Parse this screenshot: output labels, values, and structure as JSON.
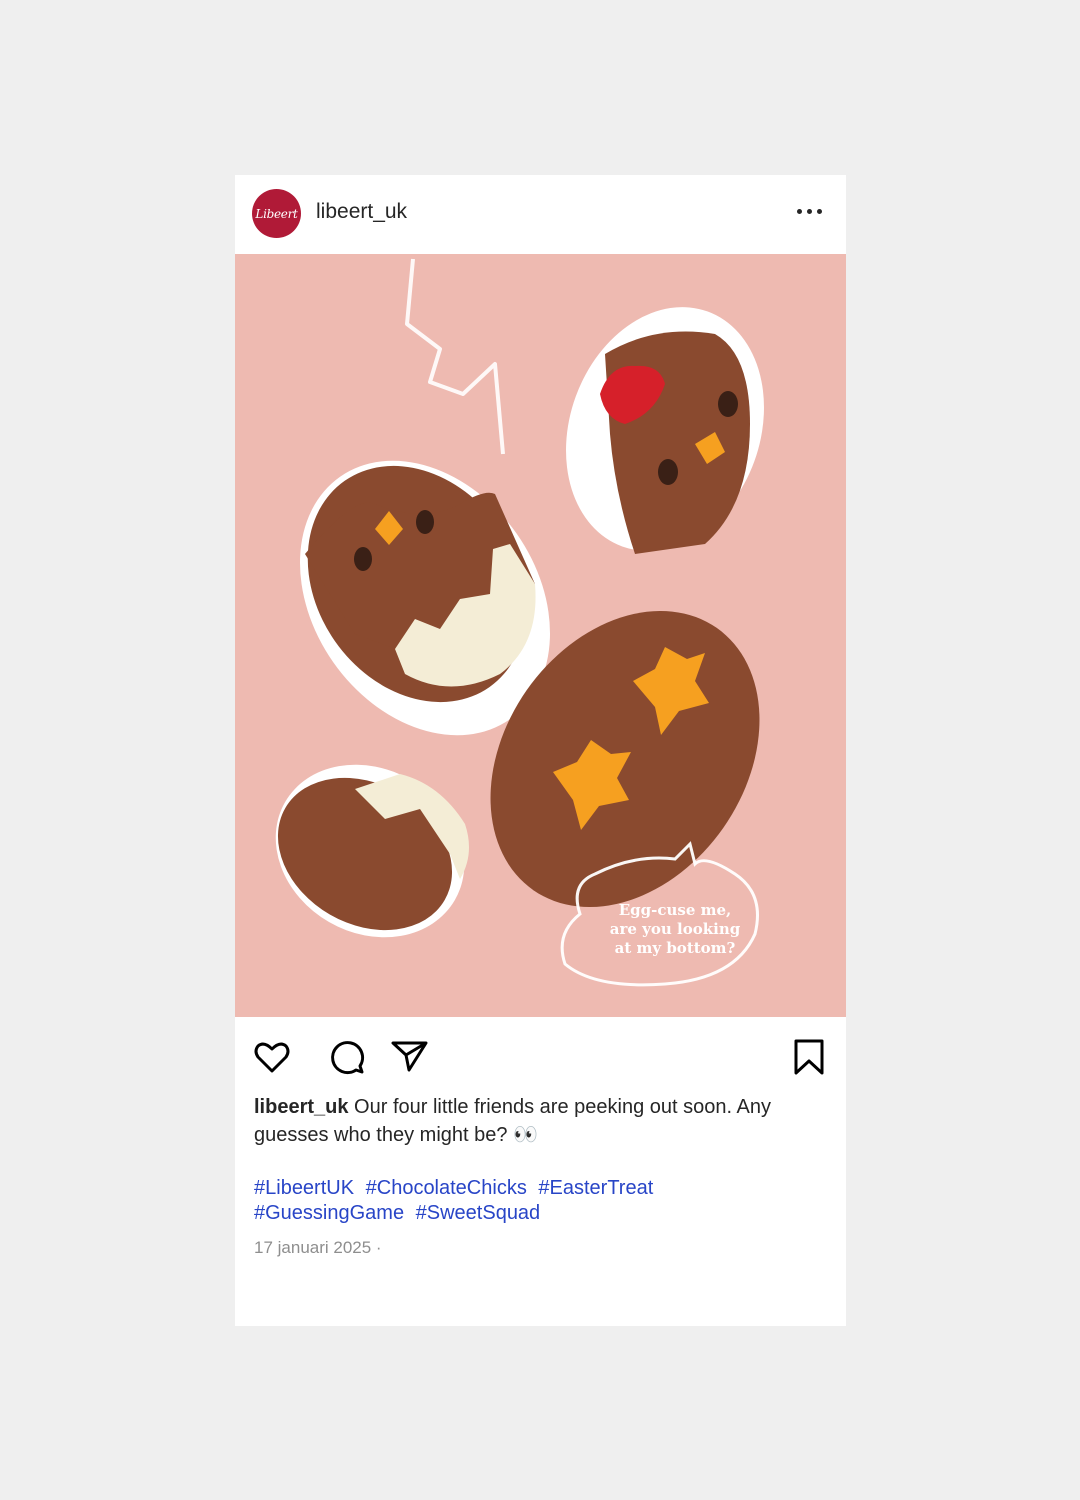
{
  "post": {
    "username": "libeert_uk",
    "avatar_text": "Libeert",
    "image_overlay": {
      "line1": "Egg-cuse me,",
      "line2": "are you looking",
      "line3": "at my bottom?"
    },
    "caption_user": "libeert_uk",
    "caption_text": " Our four little friends are peeking out soon. Any guesses who they might be? 👀",
    "hashtags": [
      "#LibeertUK",
      "#ChocolateChicks",
      "#EasterTreat",
      "#GuessingGame",
      "#SweetSquad"
    ],
    "date": "17 januari 2025 ·"
  },
  "colors": {
    "brand": "#b01a37",
    "image_bg": "#eebab1",
    "hashtag": "#2845c7"
  },
  "icons": [
    "more-icon",
    "heart-icon",
    "comment-icon",
    "share-icon",
    "bookmark-icon"
  ]
}
